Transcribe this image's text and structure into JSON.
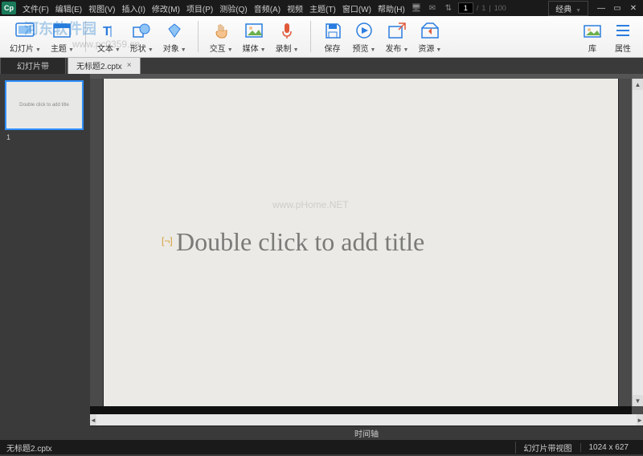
{
  "app": {
    "icon": "Cp",
    "layout": "经典"
  },
  "menu": {
    "file": "文件(F)",
    "edit": "编辑(E)",
    "view": "视图(V)",
    "insert": "插入(I)",
    "modify": "修改(M)",
    "project": "项目(P)",
    "quiz": "测验(Q)",
    "audio": "音频(A)",
    "video": "视频",
    "theme": "主题(T)",
    "window": "窗口(W)",
    "help": "帮助(H)"
  },
  "page": {
    "current": "1",
    "sep": "/",
    "total": "1",
    "zoom": "100"
  },
  "toolbar": {
    "slides": "幻灯片",
    "themes": "主题",
    "text": "文本",
    "shapes": "形状",
    "objects": "对象",
    "interactions": "交互",
    "media": "媒体",
    "record": "录制",
    "save": "保存",
    "preview": "预览",
    "publish": "发布",
    "assets": "资源",
    "library": "库",
    "properties": "属性"
  },
  "tabs": {
    "filmstrip": "幻灯片带",
    "document": "无标题2.cptx"
  },
  "thumb": {
    "text": "Double click to add title",
    "num": "1"
  },
  "slide": {
    "title_placeholder": "Double click to add title"
  },
  "timeline": {
    "label": "时间轴"
  },
  "status": {
    "file": "无标题2.cptx",
    "view": "幻灯片带视图",
    "dims": "1024 x 627"
  },
  "watermarks": {
    "logo": "河东软件园",
    "url1": "www.pc0359.cn",
    "url2": "www.pHome.NET"
  }
}
